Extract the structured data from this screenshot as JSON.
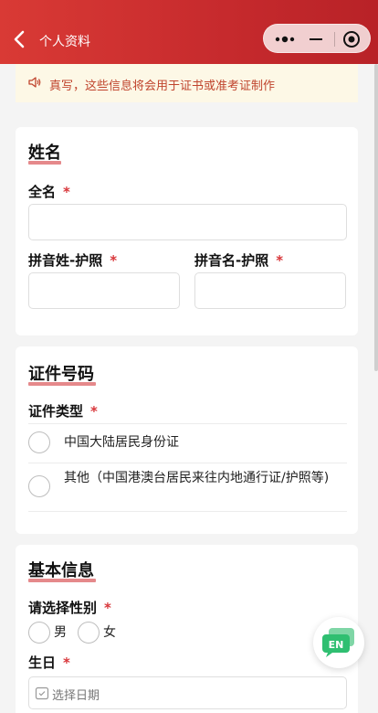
{
  "header": {
    "title": "个人资料"
  },
  "notice": {
    "text": "真写，这些信息将会用于证书或准考证制作"
  },
  "name_section": {
    "title": "姓名",
    "full_name_label": "全名",
    "pinyin_surname_label": "拼音姓-护照",
    "pinyin_given_label": "拼音名-护照",
    "required_mark": "*"
  },
  "id_section": {
    "title": "证件号码",
    "type_label": "证件类型",
    "options": [
      "中国大陆居民身份证",
      "其他（中国港澳台居民来往内地通行证/护照等)"
    ]
  },
  "basic_section": {
    "title": "基本信息",
    "gender_label": "请选择性别",
    "gender_options": [
      "男",
      "女"
    ],
    "birthday_label": "生日",
    "birthday_placeholder": "选择日期"
  },
  "fab": {
    "text": "EN"
  },
  "colors": {
    "header": "#c62a2d",
    "accent": "#d8363a",
    "underline": "#e5898b",
    "notice_bg": "#fdf8e6"
  },
  "icons": [
    "chevron-left-icon",
    "more-dots-icon",
    "minimize-icon",
    "close-target-icon",
    "speaker-icon",
    "calendar-icon",
    "chat-bubble-icon"
  ]
}
